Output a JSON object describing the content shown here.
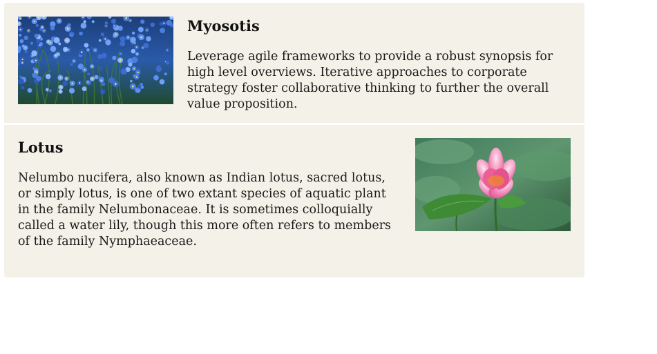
{
  "cards": [
    {
      "title": "Myosotis",
      "text": "Leverage agile frameworks to provide a robust synopsis for high level overviews. Iterative approaches to corporate strategy foster collaborative thinking to further the overall value proposition.",
      "image": "myosotis-flowers-photo"
    },
    {
      "title": "Lotus",
      "text": "Nelumbo nucifera, also known as Indian lotus, sacred lotus, or simply lotus, is one of two extant species of aquatic plant in the family Nelumbonaceae. It is sometimes colloquially called a water lily, though this more often refers to members of the family Nymphaeaceae.",
      "image": "lotus-flower-photo"
    }
  ],
  "colors": {
    "card_background": "#f4f1e8",
    "page_background": "#ffffff"
  }
}
